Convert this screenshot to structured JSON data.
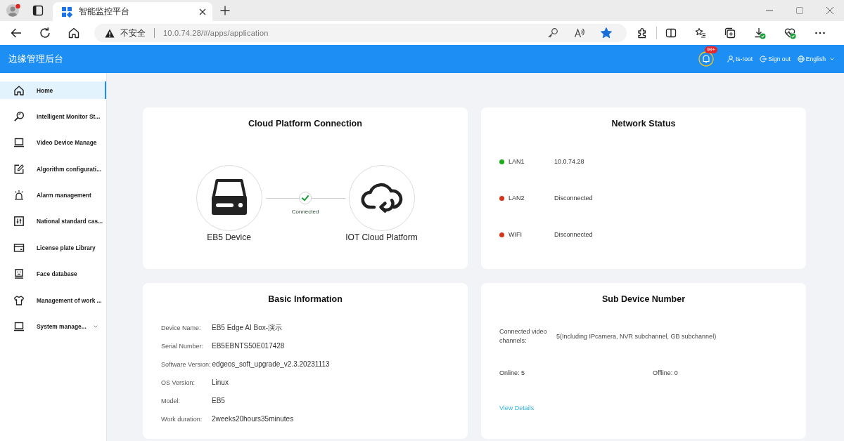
{
  "browser": {
    "tab": {
      "title": "智能监控平台"
    },
    "address_bar": {
      "security_label": "不安全",
      "url": "10.0.74.28/#/apps/application",
      "favorited": true
    }
  },
  "header": {
    "title": "边缘管理后台",
    "notification_count": "99+",
    "user": "ts-root",
    "sign_out": "Sign out",
    "language": "English"
  },
  "sidebar": {
    "items": [
      {
        "label": "Home",
        "kind": "link",
        "selected": true
      },
      {
        "label": "Intelligent Monitor St...",
        "kind": "link",
        "selected": false
      },
      {
        "label": "Video Device Manage",
        "kind": "link",
        "selected": false
      },
      {
        "label": "Algorithm configurati...",
        "kind": "link",
        "selected": false
      },
      {
        "label": "Alarm management",
        "kind": "link",
        "selected": false
      },
      {
        "label": "National standard cas...",
        "kind": "link",
        "selected": false
      },
      {
        "label": "License plate Library",
        "kind": "link",
        "selected": false
      },
      {
        "label": "Face database",
        "kind": "link",
        "selected": false
      },
      {
        "label": "Management of work ...",
        "kind": "link",
        "selected": false
      },
      {
        "label": "System manage...",
        "kind": "submenu",
        "selected": false
      }
    ]
  },
  "cloud_connection": {
    "title": "Cloud Platform Connection",
    "device": "EB5 Device",
    "platform": "IOT Cloud Platform",
    "status": "Connected",
    "connected": true
  },
  "network_status": {
    "title": "Network Status",
    "interfaces": [
      {
        "name": "LAN1",
        "value": "10.0.74.28",
        "color": "#1aad19"
      },
      {
        "name": "LAN2",
        "value": "Disconnected",
        "color": "#d4361b"
      },
      {
        "name": "WIFI",
        "value": "Disconnected",
        "color": "#d4361b"
      }
    ]
  },
  "basic_information": {
    "title": "Basic Information",
    "fields": [
      {
        "label": "Device Name:",
        "value": "EB5 Edge AI Box-演示"
      },
      {
        "label": "Serial Number:",
        "value": "EB5EBNTS50E017428"
      },
      {
        "label": "Software Version:",
        "value": "edgeos_soft_upgrade_v2.3.20231113"
      },
      {
        "label": "OS Version:",
        "value": "Linux"
      },
      {
        "label": "Model:",
        "value": "EB5"
      },
      {
        "label": "Work duration:",
        "value": "2weeks20hours35minutes"
      }
    ]
  },
  "sub_devices": {
    "title": "Sub Device Number",
    "channels_label": "Connected video channels:",
    "channels_value": "5(Including IPcamera, NVR subchannel, GB subchannel)",
    "online": "Online: 5",
    "offline": "Offline: 0",
    "details_link": "View Details"
  }
}
